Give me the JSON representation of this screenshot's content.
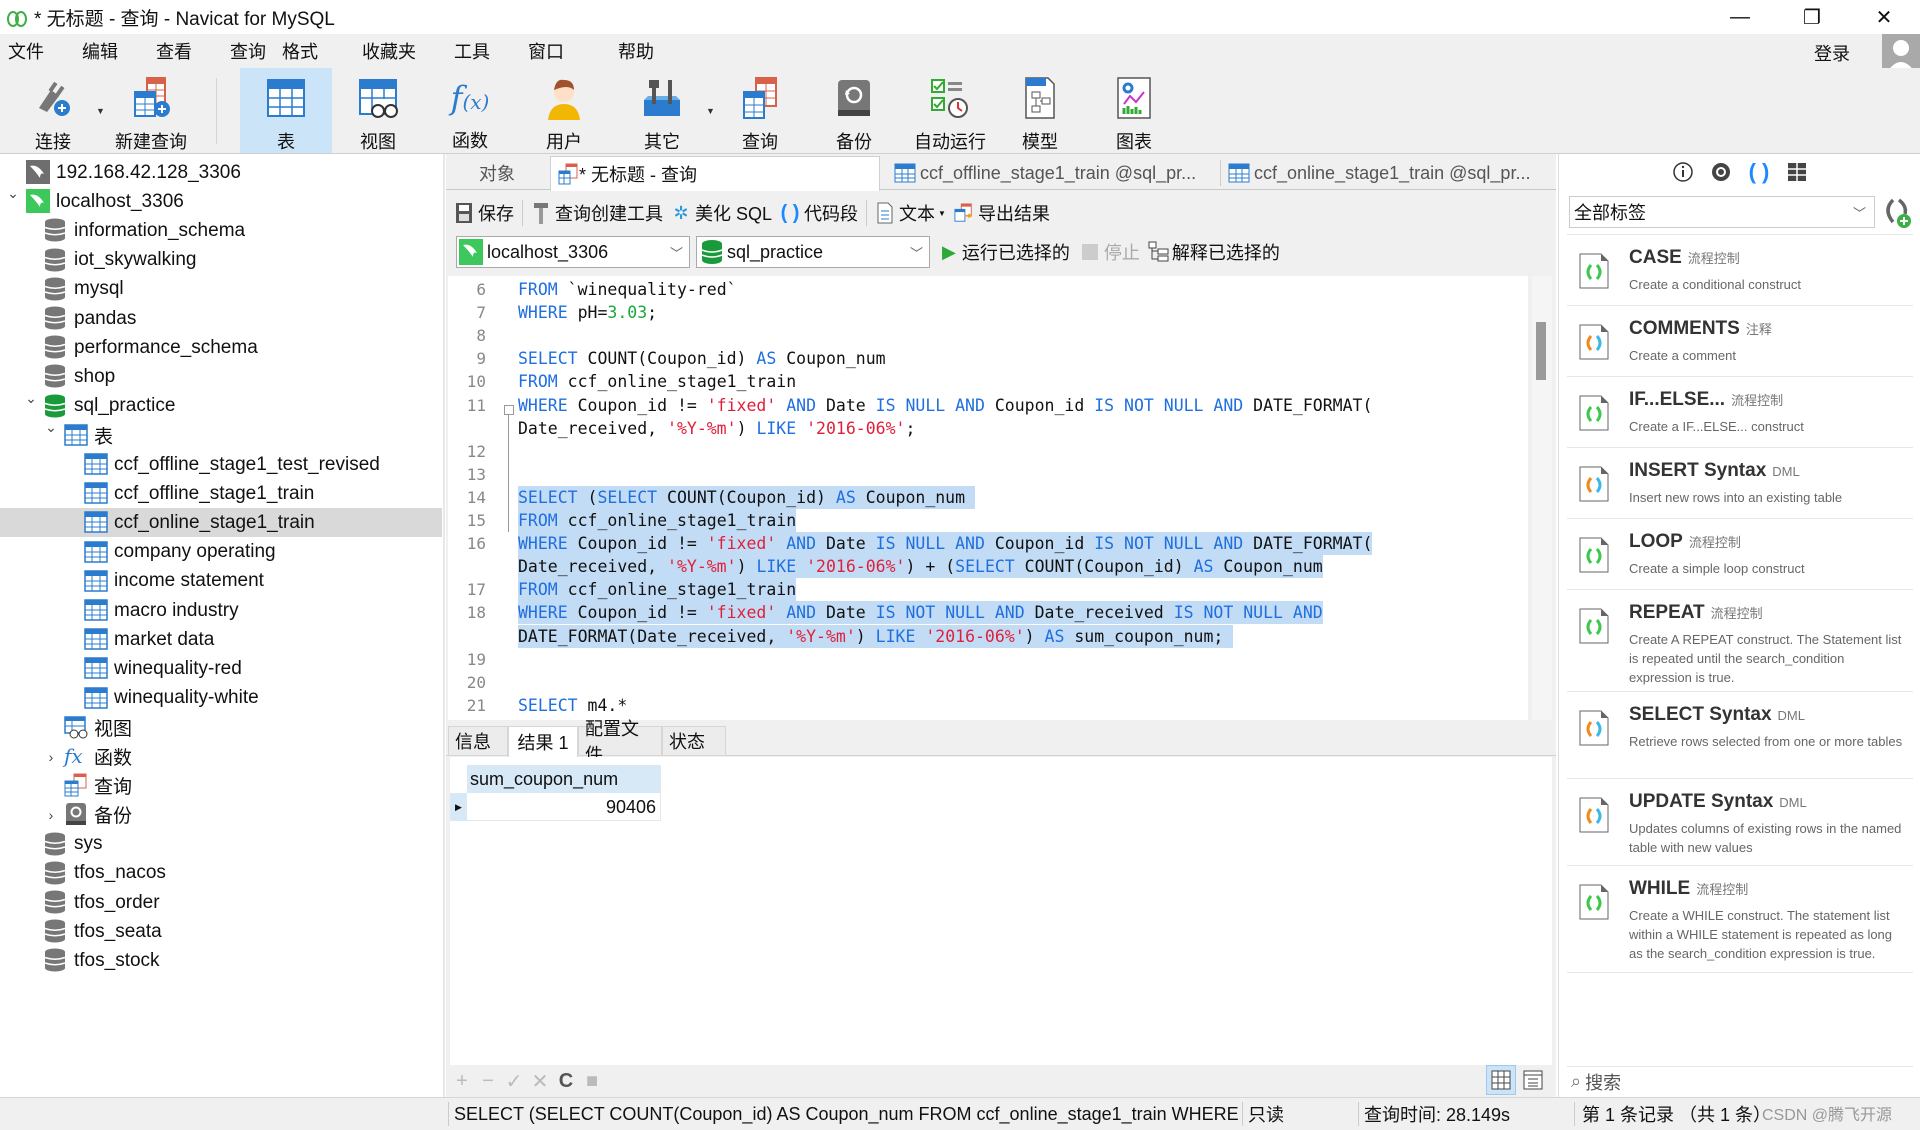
{
  "window": {
    "title": "* 无标题 - 查询 - Navicat for MySQL",
    "minimize_icon": "minimize-icon",
    "restore_icon": "restore-icon",
    "close_icon": "close-icon"
  },
  "menu": [
    "文件",
    "编辑",
    "查看",
    "查询",
    "格式",
    "收藏夹",
    "工具",
    "窗口",
    "帮助"
  ],
  "account": {
    "login_label": "登录"
  },
  "toolbar": {
    "items": [
      {
        "label": "连接",
        "icon": "plug-connect-icon"
      },
      {
        "label": "新建查询",
        "icon": "new-query-icon"
      },
      {
        "label": "表",
        "icon": "table-icon",
        "active": true
      },
      {
        "label": "视图",
        "icon": "view-icon"
      },
      {
        "label": "函数",
        "icon": "function-icon"
      },
      {
        "label": "用户",
        "icon": "user-icon"
      },
      {
        "label": "其它",
        "icon": "tools-icon"
      },
      {
        "label": "查询",
        "icon": "query-icon"
      },
      {
        "label": "备份",
        "icon": "backup-icon"
      },
      {
        "label": "自动运行",
        "icon": "schedule-icon"
      },
      {
        "label": "模型",
        "icon": "model-icon"
      },
      {
        "label": "图表",
        "icon": "chart-icon"
      }
    ]
  },
  "tree": {
    "items": [
      {
        "label": "192.168.42.128_3306",
        "type": "connection-off",
        "level": 0
      },
      {
        "label": "localhost_3306",
        "type": "connection-on",
        "level": 0,
        "expanded": true
      },
      {
        "label": "information_schema",
        "type": "database",
        "level": 1
      },
      {
        "label": "iot_skywalking",
        "type": "database",
        "level": 1
      },
      {
        "label": "mysql",
        "type": "database",
        "level": 1
      },
      {
        "label": "pandas",
        "type": "database",
        "level": 1
      },
      {
        "label": "performance_schema",
        "type": "database",
        "level": 1
      },
      {
        "label": "shop",
        "type": "database",
        "level": 1
      },
      {
        "label": "sql_practice",
        "type": "database-open",
        "level": 1,
        "expanded": true
      },
      {
        "label": "表",
        "type": "tables-folder",
        "level": 2,
        "expanded": true
      },
      {
        "label": "ccf_offline_stage1_test_revised",
        "type": "table",
        "level": 3
      },
      {
        "label": "ccf_offline_stage1_train",
        "type": "table",
        "level": 3
      },
      {
        "label": "ccf_online_stage1_train",
        "type": "table",
        "level": 3,
        "selected": true
      },
      {
        "label": "company operating",
        "type": "table",
        "level": 3
      },
      {
        "label": "income statement",
        "type": "table",
        "level": 3
      },
      {
        "label": "macro industry",
        "type": "table",
        "level": 3
      },
      {
        "label": "market data",
        "type": "table",
        "level": 3
      },
      {
        "label": "winequality-red",
        "type": "table",
        "level": 3
      },
      {
        "label": "winequality-white",
        "type": "table",
        "level": 3
      },
      {
        "label": "视图",
        "type": "views-folder",
        "level": 2
      },
      {
        "label": "函数",
        "type": "functions-folder",
        "level": 2,
        "collapsed": true
      },
      {
        "label": "查询",
        "type": "queries-folder",
        "level": 2
      },
      {
        "label": "备份",
        "type": "backups-folder",
        "level": 2,
        "collapsed": true
      },
      {
        "label": "sys",
        "type": "database",
        "level": 1
      },
      {
        "label": "tfos_nacos",
        "type": "database",
        "level": 1
      },
      {
        "label": "tfos_order",
        "type": "database",
        "level": 1
      },
      {
        "label": "tfos_seata",
        "type": "database",
        "level": 1
      },
      {
        "label": "tfos_stock",
        "type": "database",
        "level": 1
      }
    ]
  },
  "tabs": [
    {
      "label": "对象"
    },
    {
      "label": "* 无标题 - 查询",
      "active": true
    },
    {
      "label": "ccf_offline_stage1_train @sql_pr..."
    },
    {
      "label": "ccf_online_stage1_train @sql_pr..."
    }
  ],
  "query_toolbar": {
    "save": "保存",
    "query_builder": "查询创建工具",
    "beautify": "美化 SQL",
    "snippet": "代码段",
    "text": "文本",
    "export": "导出结果"
  },
  "connection_row": {
    "connection": "localhost_3306",
    "database": "sql_practice",
    "run_selected": "运行已选择的",
    "stop": "停止",
    "explain_selected": "解释已选择的"
  },
  "editor": {
    "lines": [
      {
        "n": "6",
        "tokens": [
          [
            "kw",
            "FROM"
          ],
          [
            "t",
            " `winequality-red`"
          ]
        ]
      },
      {
        "n": "7",
        "tokens": [
          [
            "kw",
            "WHERE"
          ],
          [
            "t",
            " pH="
          ],
          [
            "num",
            "3.03"
          ],
          [
            "t",
            ";"
          ]
        ]
      },
      {
        "n": "8",
        "tokens": []
      },
      {
        "n": "9",
        "tokens": [
          [
            "kw",
            "SELECT"
          ],
          [
            "t",
            " COUNT(Coupon_id) "
          ],
          [
            "kw",
            "AS"
          ],
          [
            "t",
            " Coupon_num"
          ]
        ]
      },
      {
        "n": "10",
        "tokens": [
          [
            "kw",
            "FROM"
          ],
          [
            "t",
            " ccf_online_stage1_train"
          ]
        ]
      },
      {
        "n": "11",
        "tokens": [
          [
            "kw",
            "WHERE"
          ],
          [
            "t",
            " Coupon_id != "
          ],
          [
            "str",
            "'fixed'"
          ],
          [
            "t",
            " "
          ],
          [
            "kw",
            "AND"
          ],
          [
            "t",
            " Date "
          ],
          [
            "kw",
            "IS NULL AND"
          ],
          [
            "t",
            " Coupon_id "
          ],
          [
            "kw",
            "IS NOT NULL AND"
          ],
          [
            "t",
            " DATE_FORMAT("
          ]
        ]
      },
      {
        "n": "",
        "tokens": [
          [
            "t",
            "Date_received, "
          ],
          [
            "str",
            "'%Y-%m'"
          ],
          [
            "t",
            ") "
          ],
          [
            "kw",
            "LIKE"
          ],
          [
            "t",
            " "
          ],
          [
            "str",
            "'2016-06%'"
          ],
          [
            "t",
            ";"
          ]
        ]
      },
      {
        "n": "12",
        "tokens": []
      },
      {
        "n": "13",
        "tokens": []
      },
      {
        "n": "14",
        "sel": true,
        "tokens": [
          [
            "kw",
            "SELECT"
          ],
          [
            "t",
            " ("
          ],
          [
            "kw",
            "SELECT"
          ],
          [
            "t",
            " COUNT(Coupon_id) "
          ],
          [
            "kw",
            "AS"
          ],
          [
            "t",
            " Coupon_num "
          ]
        ]
      },
      {
        "n": "15",
        "sel": true,
        "tokens": [
          [
            "kw",
            "FROM"
          ],
          [
            "t",
            " ccf_online_stage1_train"
          ]
        ]
      },
      {
        "n": "16",
        "sel": true,
        "tokens": [
          [
            "kw",
            "WHERE"
          ],
          [
            "t",
            " Coupon_id != "
          ],
          [
            "str",
            "'fixed'"
          ],
          [
            "t",
            " "
          ],
          [
            "kw",
            "AND"
          ],
          [
            "t",
            " Date "
          ],
          [
            "kw",
            "IS NULL AND"
          ],
          [
            "t",
            " Coupon_id "
          ],
          [
            "kw",
            "IS NOT NULL AND"
          ],
          [
            "t",
            " DATE_FORMAT("
          ]
        ]
      },
      {
        "n": "",
        "sel": true,
        "tokens": [
          [
            "t",
            "Date_received, "
          ],
          [
            "str",
            "'%Y-%m'"
          ],
          [
            "t",
            ") "
          ],
          [
            "kw",
            "LIKE"
          ],
          [
            "t",
            " "
          ],
          [
            "str",
            "'2016-06%'"
          ],
          [
            "t",
            ") + ("
          ],
          [
            "kw",
            "SELECT"
          ],
          [
            "t",
            " COUNT(Coupon_id) "
          ],
          [
            "kw",
            "AS"
          ],
          [
            "t",
            " Coupon_num"
          ]
        ]
      },
      {
        "n": "17",
        "sel": true,
        "tokens": [
          [
            "kw",
            "FROM"
          ],
          [
            "t",
            " ccf_online_stage1_train"
          ]
        ]
      },
      {
        "n": "18",
        "sel": true,
        "tokens": [
          [
            "kw",
            "WHERE"
          ],
          [
            "t",
            " Coupon_id != "
          ],
          [
            "str",
            "'fixed'"
          ],
          [
            "t",
            " "
          ],
          [
            "kw",
            "AND"
          ],
          [
            "t",
            " Date "
          ],
          [
            "kw",
            "IS NOT NULL AND"
          ],
          [
            "t",
            " Date_received "
          ],
          [
            "kw",
            "IS NOT NULL AND"
          ]
        ]
      },
      {
        "n": "",
        "sel": true,
        "tokens": [
          [
            "t",
            "DATE_FORMAT(Date_received, "
          ],
          [
            "str",
            "'%Y-%m'"
          ],
          [
            "t",
            ") "
          ],
          [
            "kw",
            "LIKE"
          ],
          [
            "t",
            " "
          ],
          [
            "str",
            "'2016-06%'"
          ],
          [
            "t",
            ") "
          ],
          [
            "kw",
            "AS"
          ],
          [
            "t",
            " sum_coupon_num; "
          ]
        ]
      },
      {
        "n": "19",
        "tokens": []
      },
      {
        "n": "20",
        "tokens": []
      },
      {
        "n": "21",
        "tokens": [
          [
            "kw",
            "SELECT"
          ],
          [
            "t",
            " m4.*"
          ]
        ]
      }
    ]
  },
  "result_tabs": [
    {
      "label": "信息"
    },
    {
      "label": "结果 1",
      "active": true
    },
    {
      "label": "配置文件"
    },
    {
      "label": "状态"
    }
  ],
  "result": {
    "columns": [
      "sum_coupon_num"
    ],
    "rows": [
      [
        "90406"
      ]
    ]
  },
  "status": {
    "sql": "SELECT (SELECT COUNT(Coupon_id) AS Coupon_num FROM ccf_online_stage1_train WHERE",
    "mode": "只读",
    "query_time": "查询时间: 28.149s",
    "record": "第 1 条记录 （共 1 条）"
  },
  "snippets_panel": {
    "filter": "全部标签",
    "search_placeholder": "搜索",
    "items": [
      {
        "name": "CASE",
        "tag": "流程控制",
        "desc": "Create a conditional construct",
        "icon": "green"
      },
      {
        "name": "COMMENTS",
        "tag": "注释",
        "desc": "Create a comment",
        "icon": "multi"
      },
      {
        "name": "IF...ELSE...",
        "tag": "流程控制",
        "desc": "Create a IF...ELSE... construct",
        "icon": "green"
      },
      {
        "name": "INSERT Syntax",
        "tag": "DML",
        "desc": "Insert new rows into an existing table",
        "icon": "multi"
      },
      {
        "name": "LOOP",
        "tag": "流程控制",
        "desc": "Create a simple loop construct",
        "icon": "green"
      },
      {
        "name": "REPEAT",
        "tag": "流程控制",
        "desc": "Create A REPEAT construct. The Statement list is repeated until the search_condition expression is true.",
        "icon": "green"
      },
      {
        "name": "SELECT Syntax",
        "tag": "DML",
        "desc": "Retrieve rows selected from one or more tables",
        "icon": "multi"
      },
      {
        "name": "UPDATE Syntax",
        "tag": "DML",
        "desc": "Updates columns of existing rows in the named table with new values",
        "icon": "multi"
      },
      {
        "name": "WHILE",
        "tag": "流程控制",
        "desc": "Create a WHILE construct. The statement list within a WHILE statement is repeated as long as the search_condition expression is true.",
        "icon": "green"
      }
    ]
  },
  "watermark": "CSDN @腾飞开源",
  "colors": {
    "keyword": "#1f6fe0",
    "string": "#e0203a",
    "number": "#1aa83b",
    "selection": "#c3dcf5",
    "active_tool": "#cce4f7"
  }
}
